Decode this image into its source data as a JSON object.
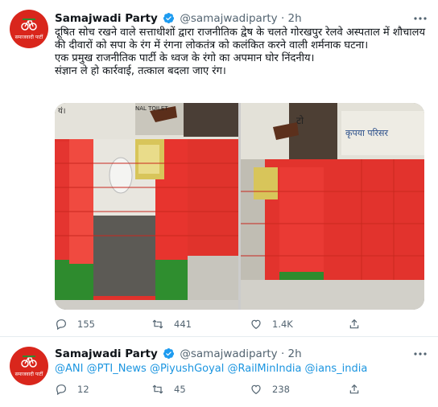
{
  "tweets": [
    {
      "name": "Samajwadi Party",
      "handle": "@samajwadiparty",
      "time": "2h",
      "avatar_text": "समाजवादी पार्टी",
      "text_lines": [
        "दूषित सोच रखने वाले सत्ताधीशों द्वारा राजनीतिक द्वेष के चलते गोरखपुर रेलवे अस्पताल में शौचालय की दीवारों को सपा के रंग में रंगना लोकतंत्र को कलंकित करने वाली शर्मनाक घटना।",
        "एक प्रमुख राजनीतिक पार्टी के ध्वज के रंगो का अपमान घोर निंदनीय।",
        "संज्ञान ले हो कार्रवाई, तत्काल बदला जाए रंग।"
      ],
      "image_sign_left": "यं।",
      "image_sign_top": "NAL TOILET",
      "image_sign_right_top": "टो",
      "image_sign_right": "कृपया परिसर",
      "replies": "155",
      "retweets": "441",
      "likes": "1.4K"
    },
    {
      "name": "Samajwadi Party",
      "handle": "@samajwadiparty",
      "time": "2h",
      "avatar_text": "समाजवादी पार्टी",
      "mentions": "@ANI @PTI_News @PiyushGoyal @RailMinIndia @ians_india",
      "replies": "12",
      "retweets": "45",
      "likes": "238"
    }
  ],
  "colors": {
    "accent": "#1b95e0",
    "party_red": "#d9261c",
    "party_green": "#2e8b2e"
  },
  "icons": [
    "verified-badge-icon",
    "more-icon",
    "reply-icon",
    "retweet-icon",
    "like-icon",
    "share-icon"
  ]
}
